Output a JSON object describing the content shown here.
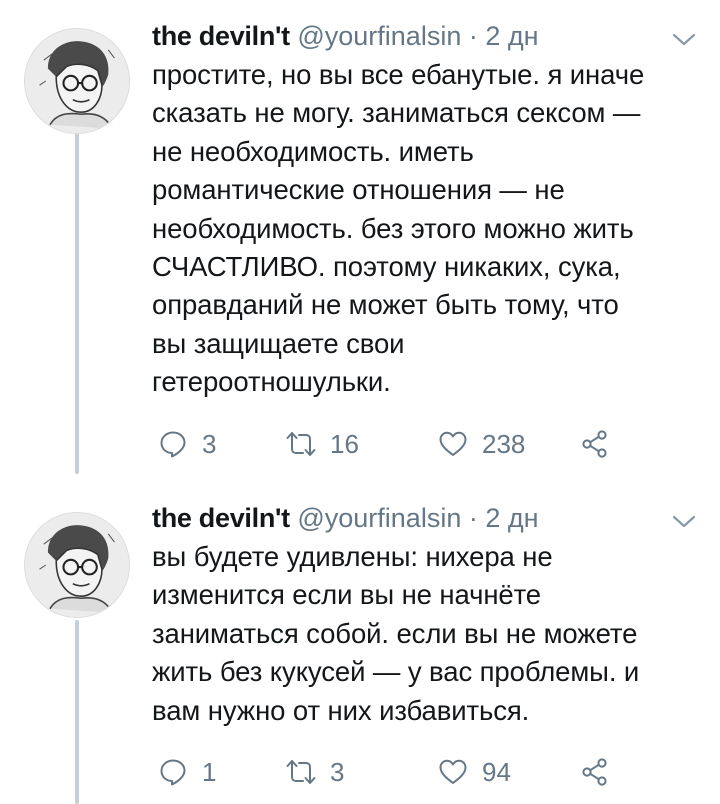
{
  "tweets": [
    {
      "author_name": "the deviln't",
      "handle": "@yourfinalsin",
      "separator": "·",
      "time": "2 дн",
      "text": "простите, но вы все ебанутые. я иначе\nсказать не могу. заниматься сексом —\nне необходимость. иметь\nромантические отношения — не\nнеобходимость. без этого можно жить\nСЧАСТЛИВО. поэтому никаких, сука,\nоправданий не может быть тому, что\nвы защищаете свои\nгетероотношульки.",
      "replies": "3",
      "retweets": "16",
      "likes": "238"
    },
    {
      "author_name": "the deviln't",
      "handle": "@yourfinalsin",
      "separator": "·",
      "time": "2 дн",
      "text": "вы будете удивлены: нихера не\nизменится если вы не начнёте\nзаниматься собой. если вы не можете\nжить без кукусей — у вас проблемы. и\nвам нужно от них избавиться.",
      "replies": "1",
      "retweets": "3",
      "likes": "94"
    }
  ],
  "icons": {
    "reply": "reply-icon",
    "retweet": "retweet-icon",
    "like": "heart-icon",
    "share": "share-icon",
    "menu": "chevron-down-icon"
  },
  "colors": {
    "text": "#14171a",
    "secondary": "#657786",
    "thread_line": "#c4cfd6",
    "background": "#ffffff"
  }
}
